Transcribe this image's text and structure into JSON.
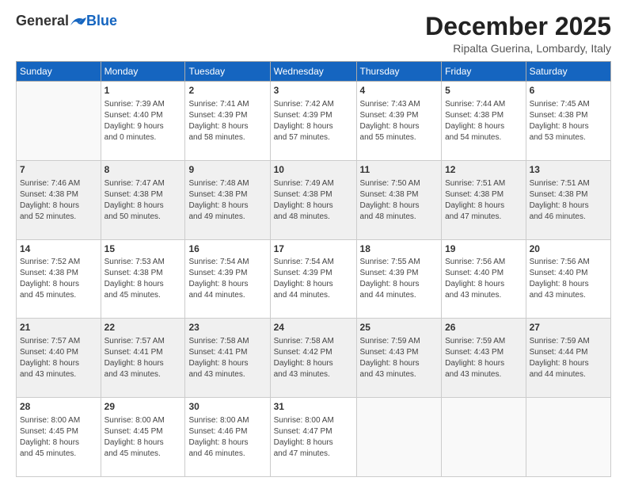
{
  "header": {
    "logo_general": "General",
    "logo_blue": "Blue",
    "month_title": "December 2025",
    "location": "Ripalta Guerina, Lombardy, Italy"
  },
  "days_of_week": [
    "Sunday",
    "Monday",
    "Tuesday",
    "Wednesday",
    "Thursday",
    "Friday",
    "Saturday"
  ],
  "weeks": [
    [
      {
        "day": "",
        "content": ""
      },
      {
        "day": "1",
        "content": "Sunrise: 7:39 AM\nSunset: 4:40 PM\nDaylight: 9 hours\nand 0 minutes."
      },
      {
        "day": "2",
        "content": "Sunrise: 7:41 AM\nSunset: 4:39 PM\nDaylight: 8 hours\nand 58 minutes."
      },
      {
        "day": "3",
        "content": "Sunrise: 7:42 AM\nSunset: 4:39 PM\nDaylight: 8 hours\nand 57 minutes."
      },
      {
        "day": "4",
        "content": "Sunrise: 7:43 AM\nSunset: 4:39 PM\nDaylight: 8 hours\nand 55 minutes."
      },
      {
        "day": "5",
        "content": "Sunrise: 7:44 AM\nSunset: 4:38 PM\nDaylight: 8 hours\nand 54 minutes."
      },
      {
        "day": "6",
        "content": "Sunrise: 7:45 AM\nSunset: 4:38 PM\nDaylight: 8 hours\nand 53 minutes."
      }
    ],
    [
      {
        "day": "7",
        "content": "Sunrise: 7:46 AM\nSunset: 4:38 PM\nDaylight: 8 hours\nand 52 minutes."
      },
      {
        "day": "8",
        "content": "Sunrise: 7:47 AM\nSunset: 4:38 PM\nDaylight: 8 hours\nand 50 minutes."
      },
      {
        "day": "9",
        "content": "Sunrise: 7:48 AM\nSunset: 4:38 PM\nDaylight: 8 hours\nand 49 minutes."
      },
      {
        "day": "10",
        "content": "Sunrise: 7:49 AM\nSunset: 4:38 PM\nDaylight: 8 hours\nand 48 minutes."
      },
      {
        "day": "11",
        "content": "Sunrise: 7:50 AM\nSunset: 4:38 PM\nDaylight: 8 hours\nand 48 minutes."
      },
      {
        "day": "12",
        "content": "Sunrise: 7:51 AM\nSunset: 4:38 PM\nDaylight: 8 hours\nand 47 minutes."
      },
      {
        "day": "13",
        "content": "Sunrise: 7:51 AM\nSunset: 4:38 PM\nDaylight: 8 hours\nand 46 minutes."
      }
    ],
    [
      {
        "day": "14",
        "content": "Sunrise: 7:52 AM\nSunset: 4:38 PM\nDaylight: 8 hours\nand 45 minutes."
      },
      {
        "day": "15",
        "content": "Sunrise: 7:53 AM\nSunset: 4:38 PM\nDaylight: 8 hours\nand 45 minutes."
      },
      {
        "day": "16",
        "content": "Sunrise: 7:54 AM\nSunset: 4:39 PM\nDaylight: 8 hours\nand 44 minutes."
      },
      {
        "day": "17",
        "content": "Sunrise: 7:54 AM\nSunset: 4:39 PM\nDaylight: 8 hours\nand 44 minutes."
      },
      {
        "day": "18",
        "content": "Sunrise: 7:55 AM\nSunset: 4:39 PM\nDaylight: 8 hours\nand 44 minutes."
      },
      {
        "day": "19",
        "content": "Sunrise: 7:56 AM\nSunset: 4:40 PM\nDaylight: 8 hours\nand 43 minutes."
      },
      {
        "day": "20",
        "content": "Sunrise: 7:56 AM\nSunset: 4:40 PM\nDaylight: 8 hours\nand 43 minutes."
      }
    ],
    [
      {
        "day": "21",
        "content": "Sunrise: 7:57 AM\nSunset: 4:40 PM\nDaylight: 8 hours\nand 43 minutes."
      },
      {
        "day": "22",
        "content": "Sunrise: 7:57 AM\nSunset: 4:41 PM\nDaylight: 8 hours\nand 43 minutes."
      },
      {
        "day": "23",
        "content": "Sunrise: 7:58 AM\nSunset: 4:41 PM\nDaylight: 8 hours\nand 43 minutes."
      },
      {
        "day": "24",
        "content": "Sunrise: 7:58 AM\nSunset: 4:42 PM\nDaylight: 8 hours\nand 43 minutes."
      },
      {
        "day": "25",
        "content": "Sunrise: 7:59 AM\nSunset: 4:43 PM\nDaylight: 8 hours\nand 43 minutes."
      },
      {
        "day": "26",
        "content": "Sunrise: 7:59 AM\nSunset: 4:43 PM\nDaylight: 8 hours\nand 43 minutes."
      },
      {
        "day": "27",
        "content": "Sunrise: 7:59 AM\nSunset: 4:44 PM\nDaylight: 8 hours\nand 44 minutes."
      }
    ],
    [
      {
        "day": "28",
        "content": "Sunrise: 8:00 AM\nSunset: 4:45 PM\nDaylight: 8 hours\nand 45 minutes."
      },
      {
        "day": "29",
        "content": "Sunrise: 8:00 AM\nSunset: 4:45 PM\nDaylight: 8 hours\nand 45 minutes."
      },
      {
        "day": "30",
        "content": "Sunrise: 8:00 AM\nSunset: 4:46 PM\nDaylight: 8 hours\nand 46 minutes."
      },
      {
        "day": "31",
        "content": "Sunrise: 8:00 AM\nSunset: 4:47 PM\nDaylight: 8 hours\nand 47 minutes."
      },
      {
        "day": "",
        "content": ""
      },
      {
        "day": "",
        "content": ""
      },
      {
        "day": "",
        "content": ""
      }
    ]
  ]
}
